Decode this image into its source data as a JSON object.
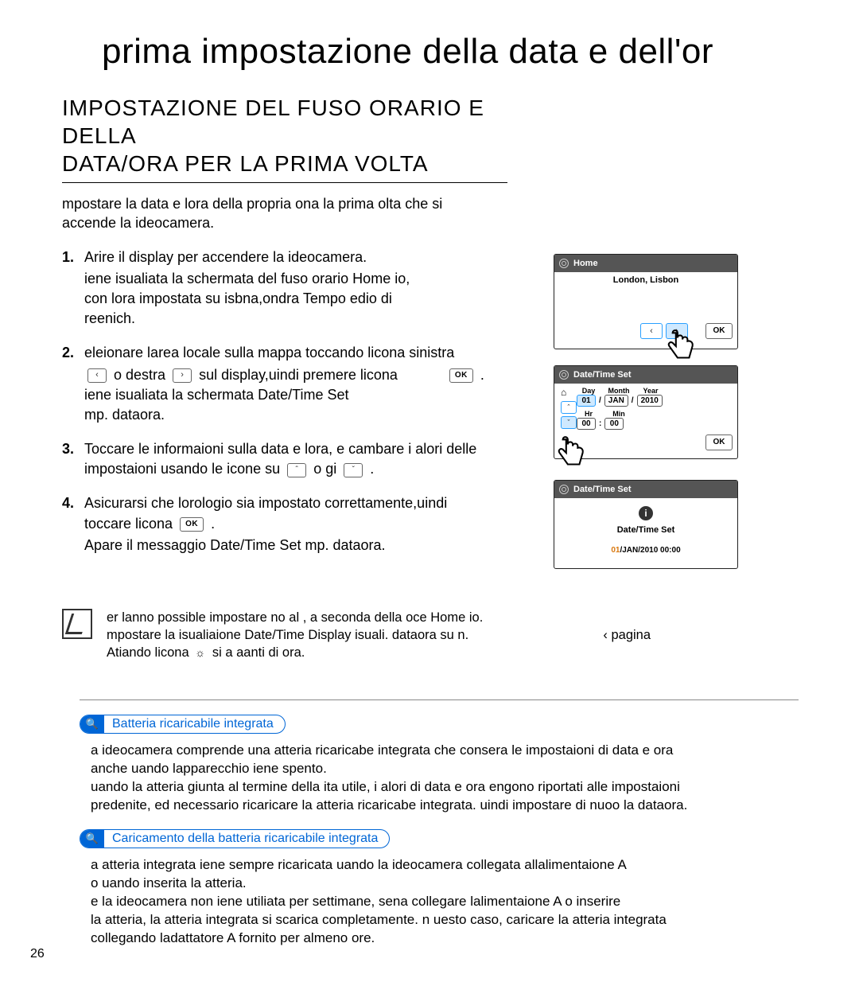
{
  "page_number": "26",
  "chapter_title": "prima impostazione della data e dell'or",
  "section_title_l1": "IMPOSTAZIONE DEL FUSO ORARIO E DELLA",
  "section_title_l2": "DATA/ORA PER LA PRIMA VOLTA",
  "intro_l1": "mpostare la data e lora della propria ona la prima olta che si",
  "intro_l2": "accende la ideocamera.",
  "steps": {
    "s1": {
      "num": "1.",
      "t1": "Arire il display per accendere la ideocamera.",
      "t2a": "iene isualiata la schermata del fuso orario Home io,",
      "t2b": "con lora impostata su isbna,ondra Tempo edio di",
      "t2c": "reenich."
    },
    "s2": {
      "num": "2.",
      "t1": "eleionare larea locale sulla mappa toccando licona sinistra",
      "t2a": "o destra",
      "t2b": "sul display,uindi premere licona",
      "t3": "iene isualiata la schermata Date/Time Set",
      "t4": "mp. dataora."
    },
    "s3": {
      "num": "3.",
      "t1": "Toccare le informaioni sulla data e lora, e cambare i alori delle",
      "t2a": "impostaioni usando le icone su",
      "t2b": "o gi"
    },
    "s4": {
      "num": "4.",
      "t1": "Asicurarsi che lorologio sia impostato correttamente,uindi",
      "t2": "toccare licona",
      "t3": "Apare il messaggio Date/Time Set mp. dataora."
    }
  },
  "icons": {
    "left": "‹",
    "right": "›",
    "up": "ˆ",
    "down": "ˇ",
    "ok": "OK"
  },
  "fig1": {
    "title": "Home",
    "location": "London, Lisbon",
    "ok": "OK"
  },
  "fig2": {
    "title": "Date/Time Set",
    "h_day": "Day",
    "h_month": "Month",
    "h_year": "Year",
    "v_day": "01",
    "v_month": "JAN",
    "v_year": "2010",
    "h_hr": "Hr",
    "h_min": "Min",
    "v_hr": "00",
    "v_min": "00",
    "ok": "OK"
  },
  "fig3": {
    "title": "Date/Time Set",
    "msg": "Date/Time Set",
    "ts_hl": "01",
    "ts_rest": "JAN/2010 00:00"
  },
  "note": {
    "l1": "er lanno possible impostare no al , a seconda della oce Home io.",
    "l2a": "mpostare la isualiaione Date/Time Display isuali. dataora su n.",
    "l2b": "‹ pagina",
    "l3a": "Atiando licona",
    "l3b": "si a aanti di  ora."
  },
  "box1": {
    "head": "Batteria ricaricabile integrata",
    "l1": "a ideocamera comprende una atteria ricaricabe integrata che consera le impostaioni di data e ora",
    "l2": "anche uando lapparecchio iene spento.",
    "l3": "uando la atteria giunta al termine della ita utile, i alori di data e ora engono riportati alle impostaioni",
    "l4": "predenite, ed necessario ricaricare la atteria ricaricabe integrata. uindi impostare di nuoo la dataora."
  },
  "box2": {
    "head": "Caricamento della batteria ricaricabile integrata",
    "l1": "a atteria integrata iene sempre ricaricata uando la ideocamera collegata allalimentaione A",
    "l2": "o uando inserita la atteria.",
    "l3": "e la ideocamera non iene utiliata per settimane, sena collegare lalimentaione A o inserire",
    "l4": "la atteria, la atteria integrata si scarica completamente. n uesto caso, caricare la atteria integrata",
    "l5": "collegando ladattatore A fornito per almeno  ore."
  }
}
